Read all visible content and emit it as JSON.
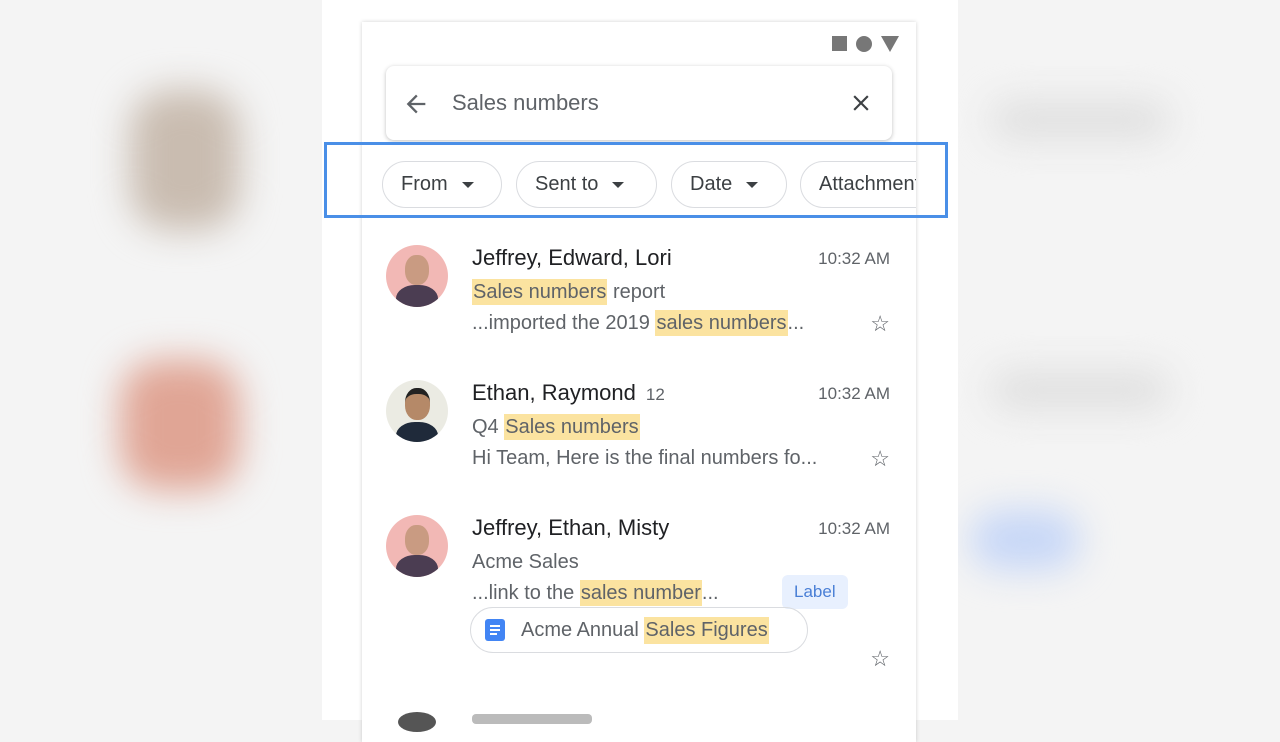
{
  "search": {
    "query": "Sales numbers",
    "back_icon": "arrow-back-icon",
    "clear_icon": "close-icon"
  },
  "status_icons": [
    "square-icon",
    "circle-icon",
    "triangle-icon"
  ],
  "filters": [
    {
      "label": "From"
    },
    {
      "label": "Sent to"
    },
    {
      "label": "Date"
    },
    {
      "label": "Attachment"
    }
  ],
  "colors": {
    "highlight": "#fbe3a0",
    "selection_border": "#4a8fe7",
    "label_bg": "#e8f0fe",
    "label_text": "#4a7fd6"
  },
  "emails": [
    {
      "sender": "Jeffrey, Edward, Lori",
      "time": "10:32 AM",
      "subject_hl": "Sales numbers",
      "subject_rest": " report",
      "snippet_pre": "...imported the 2019 ",
      "snippet_hl": "sales numbers",
      "snippet_post": "..."
    },
    {
      "sender": "Ethan, Raymond",
      "count": "12",
      "time": "10:32 AM",
      "subject_pre": "Q4 ",
      "subject_hl": "Sales numbers",
      "snippet": "Hi Team, Here is the final numbers fo..."
    },
    {
      "sender": "Jeffrey, Ethan, Misty",
      "time": "10:32 AM",
      "subject": "Acme Sales",
      "snippet_pre": "...link to the ",
      "snippet_hl": "sales number",
      "snippet_post": "...",
      "label": "Label",
      "attachment_pre": "Acme Annual ",
      "attachment_hl": "Sales Figures"
    }
  ]
}
